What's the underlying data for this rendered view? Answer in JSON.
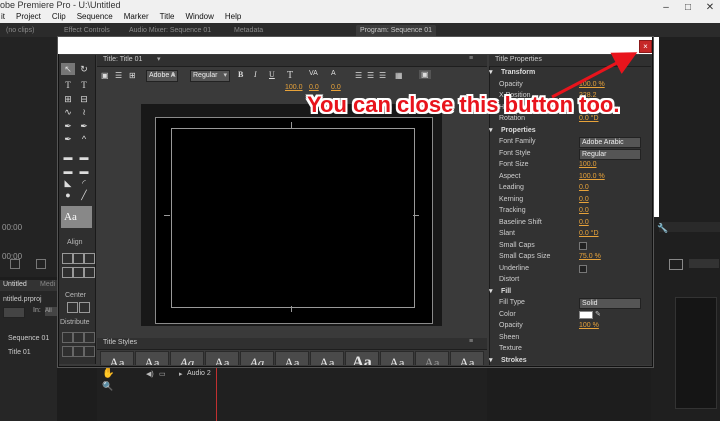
{
  "app": {
    "window_title": "obe Premiere Pro - U:\\Untitled",
    "menu": [
      "it",
      "Project",
      "Clip",
      "Sequence",
      "Marker",
      "Title",
      "Window",
      "Help"
    ]
  },
  "panel_tabs": {
    "source": "(no clips)",
    "effect_controls": "Effect Controls",
    "audio_mixer": "Audio Mixer: Sequence 01",
    "metadata": "Metadata",
    "program": "Program: Sequence 01"
  },
  "left_panel": {
    "timecode": "00:00",
    "timecode2": "00:00",
    "project_tab": "Untitled",
    "media_tab": "Medi",
    "project_file": "ntitled.prproj",
    "in_label": "In:",
    "in_value": "All",
    "items": [
      "Sequence 01",
      "Title 01"
    ]
  },
  "tools": {
    "align_label": "Align",
    "center_label": "Center",
    "distribute_label": "Distribute",
    "sample_text": "Aa"
  },
  "title_panel": {
    "tab": "Title: Title 01",
    "font_family": "Adobe A",
    "font_style": "Regular",
    "values": [
      "100.0",
      "0.0",
      "0.0"
    ],
    "bold": "B",
    "italic": "I",
    "underline": "U"
  },
  "title_styles": {
    "header": "Title Styles",
    "swatch_text": "Aa"
  },
  "properties": {
    "header": "Title Properties",
    "rows": [
      {
        "label": "Transform",
        "value": "",
        "section": true
      },
      {
        "label": "Opacity",
        "value": "100.0 %"
      },
      {
        "label": "X Position",
        "value": "328.2"
      },
      {
        "label": "Height",
        "value": "100.0"
      },
      {
        "label": "Rotation",
        "value": "0.0 °D"
      },
      {
        "label": "Properties",
        "value": "",
        "section": true
      },
      {
        "label": "Font Family",
        "value": "Adobe Arabic",
        "dropdown": true
      },
      {
        "label": "Font Style",
        "value": "Regular",
        "dropdown": true
      },
      {
        "label": "Font Size",
        "value": "100.0"
      },
      {
        "label": "Aspect",
        "value": "100.0 %"
      },
      {
        "label": "Leading",
        "value": "0.0"
      },
      {
        "label": "Kerning",
        "value": "0.0"
      },
      {
        "label": "Tracking",
        "value": "0.0"
      },
      {
        "label": "Baseline Shift",
        "value": "0.0"
      },
      {
        "label": "Slant",
        "value": "0.0 °D"
      },
      {
        "label": "Small Caps",
        "value": "",
        "check": true
      },
      {
        "label": "Small Caps Size",
        "value": "75.0 %"
      },
      {
        "label": "Underline",
        "value": "",
        "check": true
      },
      {
        "label": "Distort",
        "value": ""
      },
      {
        "label": "Fill",
        "value": "",
        "section": true
      },
      {
        "label": "Fill Type",
        "value": "Solid",
        "dropdown": true
      },
      {
        "label": "Color",
        "value": ""
      },
      {
        "label": "Opacity",
        "value": "100 %"
      },
      {
        "label": "Sheen",
        "value": ""
      },
      {
        "label": "Texture",
        "value": ""
      },
      {
        "label": "Strokes",
        "value": "",
        "section": true
      }
    ]
  },
  "timeline": {
    "track": "Audio 2"
  },
  "annotation": {
    "callout": "You can close this button too.",
    "arrow_color": "#e8141c"
  },
  "close_button": {
    "glyph": "×",
    "color": "#c62828"
  }
}
